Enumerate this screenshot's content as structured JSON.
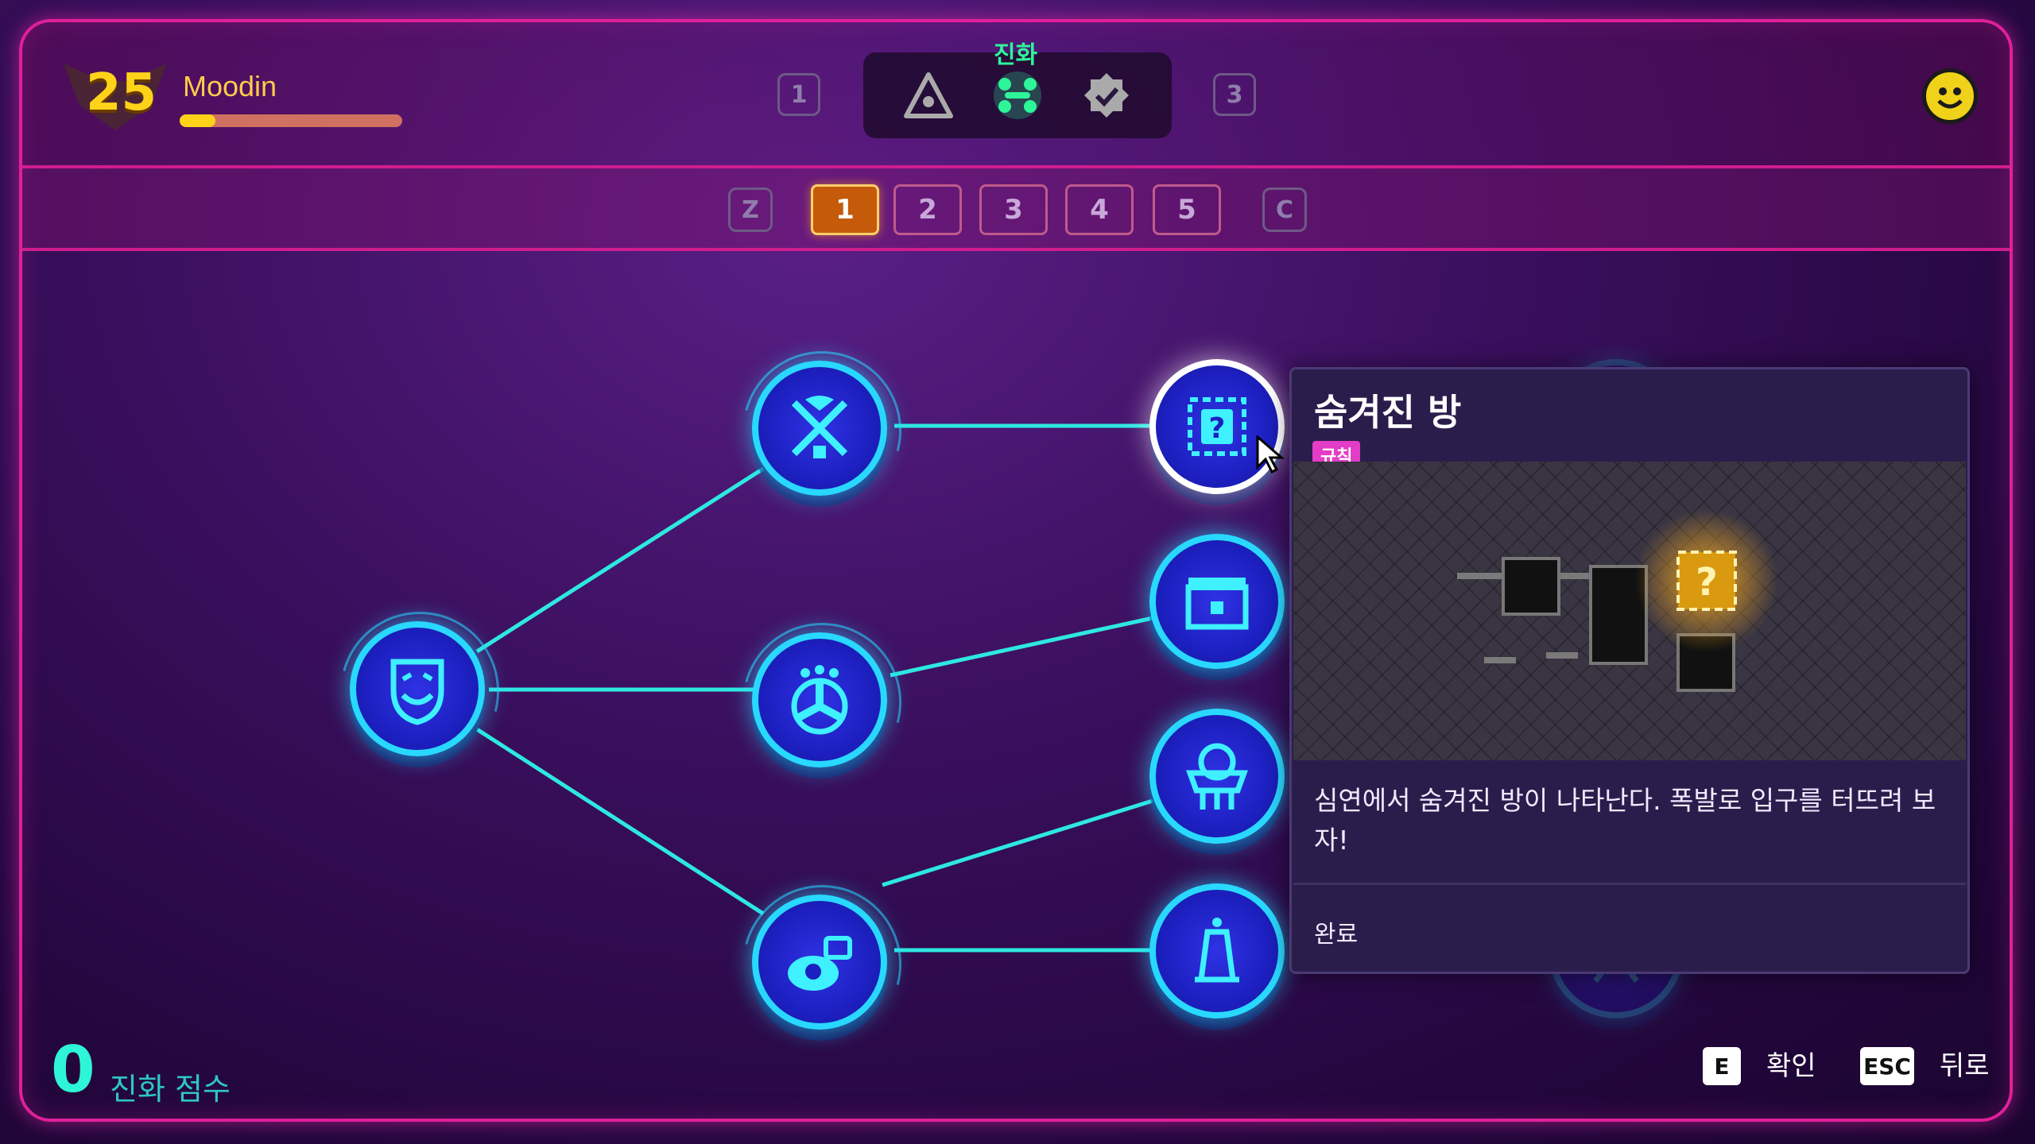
{
  "player": {
    "level": "25",
    "name": "Moodin",
    "xp_fraction": 0.16
  },
  "header": {
    "left_key": "1",
    "right_key": "3",
    "active_tab_label": "진화",
    "tabs": [
      {
        "icon": "triangle-eye-icon"
      },
      {
        "icon": "evolution-nodes-icon"
      },
      {
        "icon": "verified-badge-icon"
      }
    ]
  },
  "pages": {
    "prev_key": "Z",
    "next_key": "C",
    "items": [
      "1",
      "2",
      "3",
      "4",
      "5"
    ],
    "active": "1"
  },
  "tooltip": {
    "title": "숨겨진 방",
    "tag": "규칙",
    "description": "심연에서 숨겨진 방이 나타난다. 폭발로 입구를 터뜨려 보자!",
    "status": "완료"
  },
  "tree": {
    "nodes": [
      {
        "id": "root",
        "icon": "smiling-mask-icon"
      },
      {
        "id": "a1",
        "icon": "crossed-swords-icon"
      },
      {
        "id": "a2",
        "icon": "orb-icon"
      },
      {
        "id": "a3",
        "icon": "gem-pile-icon"
      },
      {
        "id": "b1",
        "icon": "mystery-box-icon",
        "selected": true
      },
      {
        "id": "b2",
        "icon": "chest-icon"
      },
      {
        "id": "b3",
        "icon": "basket-icon"
      },
      {
        "id": "b4",
        "icon": "tower-icon"
      },
      {
        "id": "c1",
        "icon": "sparkle-icon"
      },
      {
        "id": "c2",
        "icon": "rocket-icon"
      }
    ]
  },
  "score": {
    "value": "0",
    "label": "진화 점수"
  },
  "hints": [
    {
      "key": "E",
      "label": "확인"
    },
    {
      "key": "ESC",
      "label": "뒤로"
    }
  ],
  "colors": {
    "accent": "#29d8ff",
    "frame": "#e0209a",
    "gold": "#ffd21a",
    "tag": "#e33cc7"
  }
}
